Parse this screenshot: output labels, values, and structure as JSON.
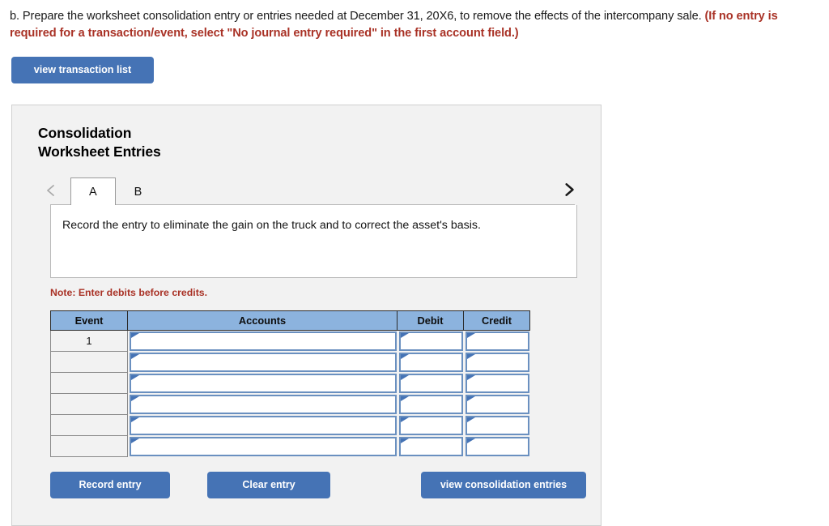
{
  "question": {
    "part_label": "b.",
    "text_before_red": "b. Prepare the worksheet consolidation entry or entries needed at December 31, 20X6, to remove the effects of the intercompany sale. ",
    "text_red": "(If no entry is required for a transaction/event, select \"No journal entry required\" in the first account field.)"
  },
  "toolbar": {
    "view_transaction_list_label": "view transaction list"
  },
  "panel": {
    "title": "Consolidation\nWorksheet Entries",
    "nav": {
      "prev_icon": "chevron-left-icon",
      "next_icon": "chevron-right-icon"
    },
    "tabs": [
      {
        "label": "A",
        "active": true
      },
      {
        "label": "B",
        "active": false
      }
    ],
    "description": "Record the entry to eliminate the gain on the truck and to correct the asset's basis.",
    "note": "Note: Enter debits before credits.",
    "table": {
      "columns": [
        "Event",
        "Accounts",
        "Debit",
        "Credit"
      ],
      "rows": [
        {
          "event": "1",
          "accounts": "",
          "debit": "",
          "credit": ""
        },
        {
          "event": "",
          "accounts": "",
          "debit": "",
          "credit": ""
        },
        {
          "event": "",
          "accounts": "",
          "debit": "",
          "credit": ""
        },
        {
          "event": "",
          "accounts": "",
          "debit": "",
          "credit": ""
        },
        {
          "event": "",
          "accounts": "",
          "debit": "",
          "credit": ""
        },
        {
          "event": "",
          "accounts": "",
          "debit": "",
          "credit": ""
        }
      ]
    },
    "actions": {
      "record_entry_label": "Record entry",
      "clear_entry_label": "Clear entry",
      "view_consolidation_entries_label": "view consolidation entries"
    }
  },
  "colors": {
    "button_blue": "#4573b5",
    "table_header_blue": "#8cb3de",
    "accent_red": "#a93226",
    "panel_bg": "#f2f2f2",
    "field_border_blue": "#6a90c0"
  }
}
